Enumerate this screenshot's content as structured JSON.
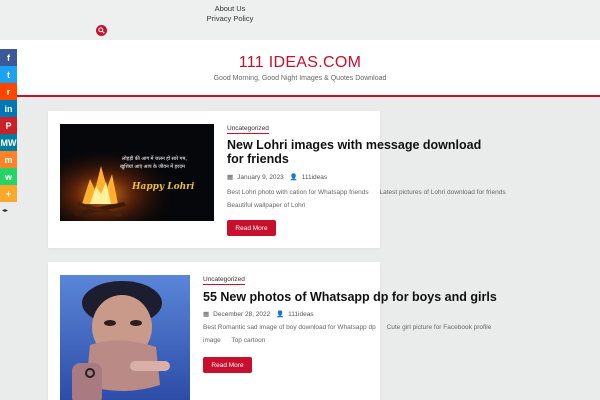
{
  "nav": {
    "items": [
      "About Us",
      "Privacy Policy"
    ]
  },
  "header": {
    "title": "111 IDEAS.COM",
    "tagline": "Good Morning, Good Night Images & Quotes Download"
  },
  "social": [
    {
      "icon": "facebook-icon",
      "color": "#3b5998",
      "glyph": "f"
    },
    {
      "icon": "twitter-icon",
      "color": "#1da1f2",
      "glyph": "t"
    },
    {
      "icon": "reddit-icon",
      "color": "#ff4500",
      "glyph": "r"
    },
    {
      "icon": "linkedin-icon",
      "color": "#0077b5",
      "glyph": "in"
    },
    {
      "icon": "pinterest-icon",
      "color": "#cb2027",
      "glyph": "P"
    },
    {
      "icon": "mewe-icon",
      "color": "#007da1",
      "glyph": "MW"
    },
    {
      "icon": "mix-icon",
      "color": "#ff8226",
      "glyph": "m"
    },
    {
      "icon": "whatsapp-icon",
      "color": "#25d366",
      "glyph": "w"
    },
    {
      "icon": "share-more-icon",
      "color": "#f9a82a",
      "glyph": "+"
    }
  ],
  "posts": [
    {
      "category": "Uncategorized",
      "title": "New Lohri images with message download for friends",
      "date": "January 9, 2023",
      "author": "111ideas",
      "tags": [
        "Best Lohri photo with cation for Whatsapp friends",
        "Latest pictures of Lohri download for friends",
        "Beautiful wallpaper of Lohri"
      ],
      "image_text": {
        "line1": "लोहड़ी की आग में जलन हो सारे गम,",
        "line2": "खुशियां आएं आप के जीवन में हरदम",
        "greeting": "Happy Lohri"
      },
      "button": "Read More"
    },
    {
      "category": "Uncategorized",
      "title": "55 New photos of Whatsapp dp for boys and girls",
      "date": "December 28, 2022",
      "author": "111ideas",
      "tags": [
        "Best Romantic sad image of boy download for Whatsapp dp",
        "Cute girl picture for Facebook profile image",
        "Top cartoon"
      ],
      "button": "Read More"
    }
  ],
  "colors": {
    "accent": "#c8102e",
    "background": "#e9ecea"
  }
}
